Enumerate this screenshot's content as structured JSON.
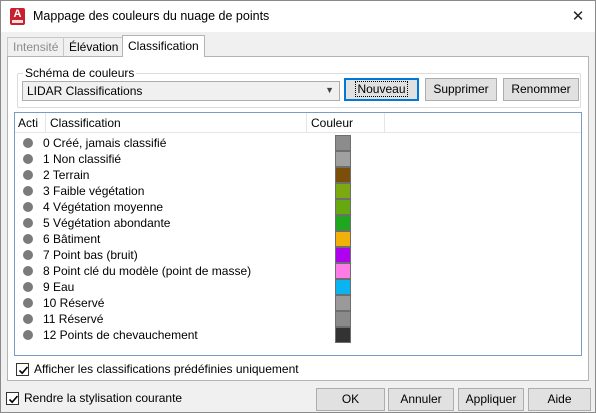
{
  "window": {
    "title": "Mappage des couleurs du nuage de points",
    "app_icon_letter": "A"
  },
  "tabs": [
    {
      "label": "Intensité",
      "state": "disabled"
    },
    {
      "label": "Élévation",
      "state": "normal"
    },
    {
      "label": "Classification",
      "state": "active"
    }
  ],
  "scheme": {
    "group_label": "Schéma de couleurs",
    "selected": "LIDAR Classifications",
    "buttons": {
      "new": "Nouveau",
      "delete": "Supprimer",
      "rename": "Renommer"
    }
  },
  "list": {
    "headers": [
      "Acti",
      "Classification",
      "Couleur"
    ],
    "rows": [
      {
        "label": "0 Créé, jamais classifié",
        "color": "#8c8c8c"
      },
      {
        "label": "1 Non classifié",
        "color": "#a0a0a0"
      },
      {
        "label": "2 Terrain",
        "color": "#7b4f0a"
      },
      {
        "label": "3 Faible végétation",
        "color": "#7ca90f"
      },
      {
        "label": "4 Végétation moyenne",
        "color": "#65a80f"
      },
      {
        "label": "5 Végétation abondante",
        "color": "#1fa81f"
      },
      {
        "label": "6 Bâtiment",
        "color": "#f2b10a"
      },
      {
        "label": "7 Point bas (bruit)",
        "color": "#b000f0"
      },
      {
        "label": "8 Point clé du modèle (point de masse)",
        "color": "#ff7ce8"
      },
      {
        "label": "9 Eau",
        "color": "#0ab4f0"
      },
      {
        "label": "10 Réservé",
        "color": "#9a9a9a"
      },
      {
        "label": "11 Réservé",
        "color": "#8a8a8a"
      },
      {
        "label": "12 Points de chevauchement",
        "color": "#333333"
      }
    ]
  },
  "options": {
    "predefined_only_label": "Afficher les classifications prédéfinies uniquement",
    "predefined_only_checked": true,
    "render_current_label": "Rendre la stylisation courante",
    "render_current_checked": true
  },
  "footer": {
    "ok": "OK",
    "cancel": "Annuler",
    "apply": "Appliquer",
    "help": "Aide"
  }
}
